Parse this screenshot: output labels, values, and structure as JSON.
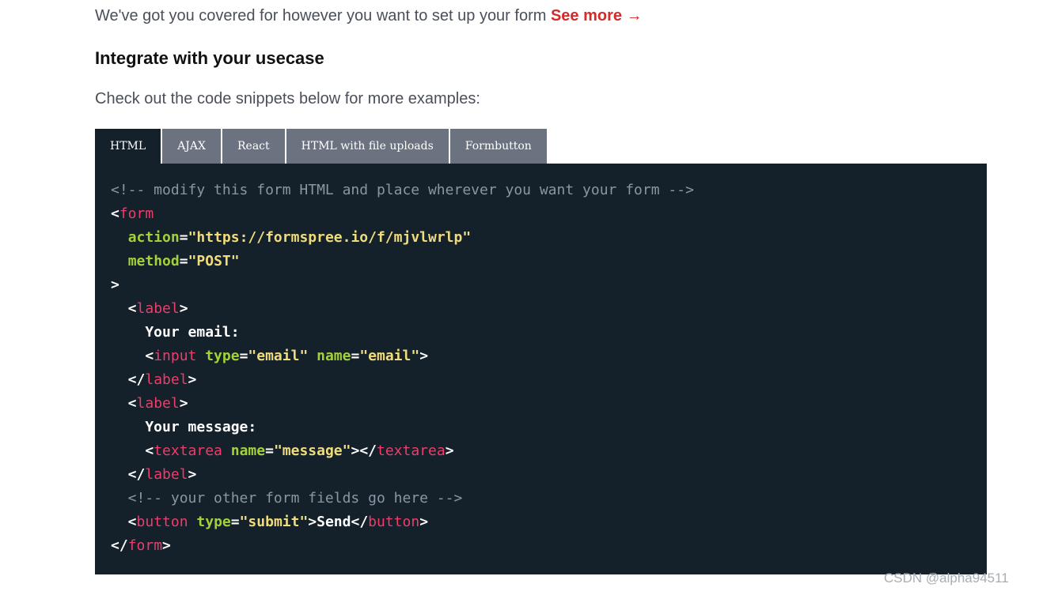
{
  "intro": {
    "text": "We've got you covered for however you want to set up your form ",
    "link_label": "See more",
    "link_arrow": "→"
  },
  "heading": "Integrate with your usecase",
  "subtext": "Check out the code snippets below for more examples:",
  "tabs": [
    {
      "label": "HTML",
      "active": true
    },
    {
      "label": "AJAX",
      "active": false
    },
    {
      "label": "React",
      "active": false
    },
    {
      "label": "HTML with file uploads",
      "active": false
    },
    {
      "label": "Formbutton",
      "active": false
    }
  ],
  "code_lines": [
    [
      {
        "t": "<!-- modify this form HTML and place wherever you want your form -->",
        "k": "com"
      }
    ],
    [
      {
        "t": "<",
        "k": "text"
      },
      {
        "t": "form",
        "k": "tag"
      }
    ],
    [
      {
        "t": "  ",
        "k": "text"
      },
      {
        "t": "action",
        "k": "attr"
      },
      {
        "t": "=",
        "k": "text"
      },
      {
        "t": "\"https://formspree.io/f/mjvlwrlp\"",
        "k": "str"
      }
    ],
    [
      {
        "t": "  ",
        "k": "text"
      },
      {
        "t": "method",
        "k": "attr"
      },
      {
        "t": "=",
        "k": "text"
      },
      {
        "t": "\"POST\"",
        "k": "str"
      }
    ],
    [
      {
        "t": ">",
        "k": "text"
      }
    ],
    [
      {
        "t": "  <",
        "k": "text"
      },
      {
        "t": "label",
        "k": "tag"
      },
      {
        "t": ">",
        "k": "text"
      }
    ],
    [
      {
        "t": "    Your email:",
        "k": "text"
      }
    ],
    [
      {
        "t": "    <",
        "k": "text"
      },
      {
        "t": "input",
        "k": "tag"
      },
      {
        "t": " ",
        "k": "text"
      },
      {
        "t": "type",
        "k": "attr"
      },
      {
        "t": "=",
        "k": "text"
      },
      {
        "t": "\"email\"",
        "k": "str"
      },
      {
        "t": " ",
        "k": "text"
      },
      {
        "t": "name",
        "k": "attr"
      },
      {
        "t": "=",
        "k": "text"
      },
      {
        "t": "\"email\"",
        "k": "str"
      },
      {
        "t": ">",
        "k": "text"
      }
    ],
    [
      {
        "t": "  </",
        "k": "text"
      },
      {
        "t": "label",
        "k": "tag"
      },
      {
        "t": ">",
        "k": "text"
      }
    ],
    [
      {
        "t": "  <",
        "k": "text"
      },
      {
        "t": "label",
        "k": "tag"
      },
      {
        "t": ">",
        "k": "text"
      }
    ],
    [
      {
        "t": "    Your message:",
        "k": "text"
      }
    ],
    [
      {
        "t": "    <",
        "k": "text"
      },
      {
        "t": "textarea",
        "k": "tag"
      },
      {
        "t": " ",
        "k": "text"
      },
      {
        "t": "name",
        "k": "attr"
      },
      {
        "t": "=",
        "k": "text"
      },
      {
        "t": "\"message\"",
        "k": "str"
      },
      {
        "t": "></",
        "k": "text"
      },
      {
        "t": "textarea",
        "k": "tag"
      },
      {
        "t": ">",
        "k": "text"
      }
    ],
    [
      {
        "t": "  </",
        "k": "text"
      },
      {
        "t": "label",
        "k": "tag"
      },
      {
        "t": ">",
        "k": "text"
      }
    ],
    [
      {
        "t": "  <!-- your other form fields go here -->",
        "k": "com"
      }
    ],
    [
      {
        "t": "  <",
        "k": "text"
      },
      {
        "t": "button",
        "k": "tag"
      },
      {
        "t": " ",
        "k": "text"
      },
      {
        "t": "type",
        "k": "attr"
      },
      {
        "t": "=",
        "k": "text"
      },
      {
        "t": "\"submit\"",
        "k": "str"
      },
      {
        "t": ">Send</",
        "k": "text"
      },
      {
        "t": "button",
        "k": "tag"
      },
      {
        "t": ">",
        "k": "text"
      }
    ],
    [
      {
        "t": "</",
        "k": "text"
      },
      {
        "t": "form",
        "k": "tag"
      },
      {
        "t": ">",
        "k": "text"
      }
    ]
  ],
  "colors": {
    "link": "#d42a2a",
    "tab_inactive": "#6b7280",
    "code_bg": "#14202a",
    "tag": "#ee3d6b",
    "attr": "#a3d13a",
    "string": "#f0dc7a",
    "comment": "#8b96a2"
  },
  "watermark": "CSDN @alpha94511"
}
